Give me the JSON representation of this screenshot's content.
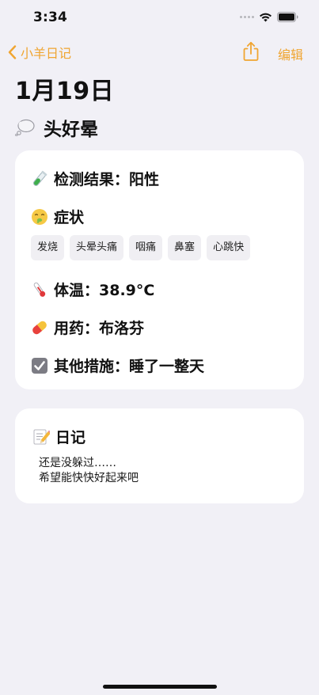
{
  "status_bar": {
    "time": "3:34",
    "icons": [
      "signal-dots-icon",
      "wifi-icon",
      "battery-icon"
    ]
  },
  "nav": {
    "back_label": "小羊日记",
    "share_icon": "share-icon",
    "edit_label": "编辑",
    "accent_color": "#f0a531"
  },
  "entry": {
    "date": "1月19日",
    "title": "头好晕",
    "title_icon": "thought-bubble-icon"
  },
  "health": {
    "test_result": "检测结果：阳性",
    "test_icon": "test-tube-icon",
    "symptoms_label": "症状",
    "symptoms_icon": "sick-face-icon",
    "symptoms": [
      "发烧",
      "头晕头痛",
      "咽痛",
      "鼻塞",
      "心跳快"
    ],
    "temperature": "体温：38.9°C",
    "temperature_icon": "thermometer-icon",
    "medication": "用药：布洛芬",
    "medication_icon": "pill-icon",
    "other_measures": "其他措施：睡了一整天",
    "other_icon": "checkbox-icon"
  },
  "diary": {
    "label": "日记",
    "icon": "memo-icon",
    "lines": [
      "还是没躲过……",
      "希望能快快好起来吧"
    ]
  }
}
